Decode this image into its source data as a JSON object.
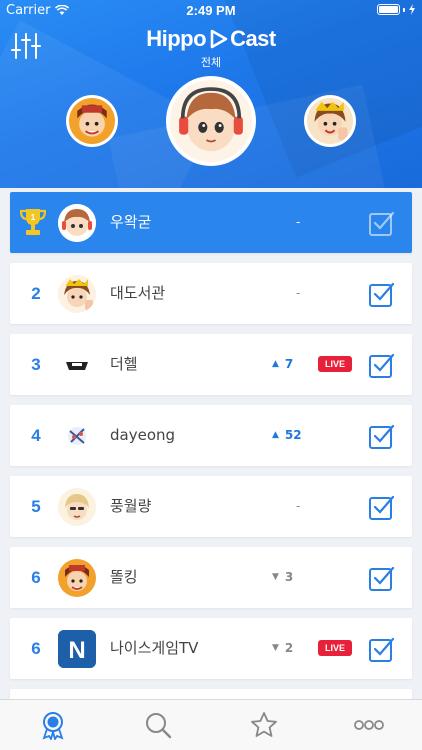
{
  "status_bar": {
    "carrier": "Carrier",
    "time": "2:49 PM"
  },
  "header": {
    "logo_left": "Hippo",
    "logo_right": "Cast",
    "subtitle": "전체"
  },
  "rows": [
    {
      "rank": "1",
      "name": "우왁굳",
      "change": "-",
      "live": ""
    },
    {
      "rank": "2",
      "name": "대도서관",
      "change": "-",
      "live": ""
    },
    {
      "rank": "3",
      "name": "더헬",
      "change": "7",
      "live": "LIVE"
    },
    {
      "rank": "4",
      "name": "dayeong",
      "change": "52",
      "live": ""
    },
    {
      "rank": "5",
      "name": "풍월량",
      "change": "-",
      "live": ""
    },
    {
      "rank": "6",
      "name": "똘킹",
      "change": "3",
      "live": ""
    },
    {
      "rank": "6",
      "name": "나이스게임TV",
      "change": "2",
      "live": "LIVE"
    }
  ],
  "colors": {
    "accent": "#2a86ec",
    "live": "#e8213b",
    "rank": "#2a7fe6"
  },
  "icons": {
    "tab_ranking": "badge-icon",
    "tab_search": "search-icon",
    "tab_favorites": "star-icon",
    "tab_more": "more-icon"
  }
}
